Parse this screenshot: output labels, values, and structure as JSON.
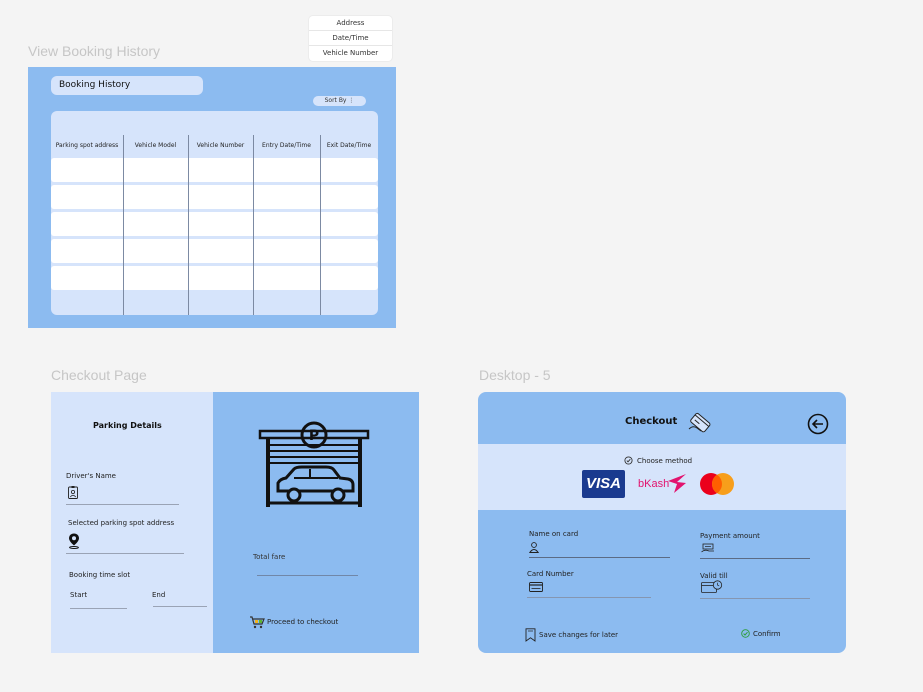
{
  "frames": {
    "booking_history": "View Booking History",
    "checkout_page": "Checkout Page",
    "desktop5": "Desktop - 5"
  },
  "sort_menu": {
    "options": [
      "Address",
      "Date/Time",
      "Vehicle Number"
    ]
  },
  "booking_history": {
    "title": "Booking History",
    "sort_label": "Sort By  ⋮",
    "columns": [
      "Parking spot address",
      "Vehicle Model",
      "Vehicle Number",
      "Entry Date/Time",
      "Exit Date/Time"
    ]
  },
  "checkout": {
    "heading": "Parking Details",
    "driver_name_label": "Driver's Name",
    "spot_address_label": "Selected parking spot address",
    "time_slot_label": "Booking time slot",
    "start_label": "Start",
    "end_label": "End",
    "total_fare_label": "Total fare",
    "proceed_label": "Proceed to checkout",
    "parking_sign_letter": "P"
  },
  "desktop5": {
    "title": "Checkout",
    "choose_method": "Choose method",
    "visa_label": "VISA",
    "bkash_label": "bKash",
    "name_on_card": "Name on card",
    "payment_amount": "Payment amount",
    "card_number": "Card Number",
    "valid_till": "Valid till",
    "save_changes": "Save changes for later",
    "confirm": "Confirm"
  },
  "colors": {
    "panel_blue": "#8cbbf0",
    "light_blue": "#d6e4fb",
    "visa_blue": "#1a3a8f",
    "bkash_pink": "#e2136e",
    "mastercard_red": "#eb001b",
    "mastercard_orange": "#f79e1b",
    "confirm_green": "#2e9e3c"
  }
}
